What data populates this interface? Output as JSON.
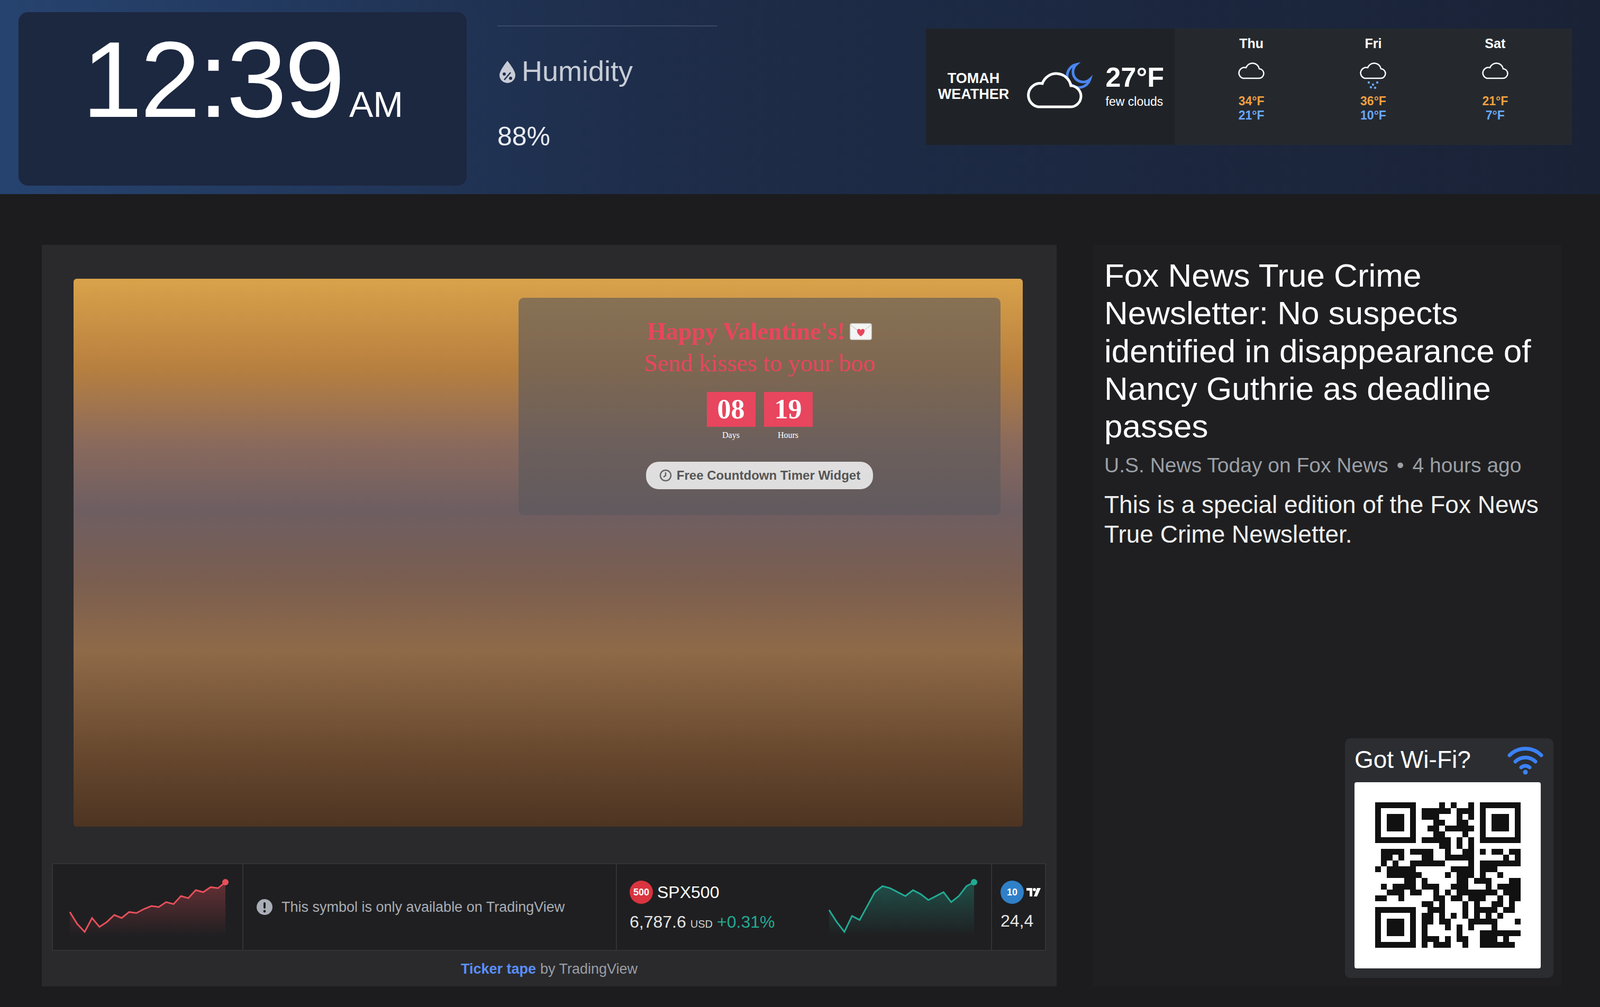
{
  "clock": {
    "time": "12:39",
    "meridiem": "AM"
  },
  "humidity": {
    "label": "Humidity",
    "value": "88%"
  },
  "weather": {
    "title": "TOMAH WEATHER",
    "temp": "27°F",
    "condition": "few clouds",
    "forecast": [
      {
        "day": "Thu",
        "kind": "cloud",
        "high": "34°F",
        "low": "21°F"
      },
      {
        "day": "Fri",
        "kind": "snow",
        "high": "36°F",
        "low": "10°F"
      },
      {
        "day": "Sat",
        "kind": "cloud",
        "high": "21°F",
        "low": "7°F"
      }
    ]
  },
  "countdown": {
    "title": "Happy Valentine's!",
    "subtitle": "Send kisses to your boo",
    "units": [
      {
        "value": "08",
        "label": "Days"
      },
      {
        "value": "19",
        "label": "Hours"
      }
    ],
    "button": "Free Countdown Timer Widget"
  },
  "ticker": {
    "items": [
      {
        "kind": "unavailable",
        "message": "This symbol is only available on TradingView",
        "color": "#e8505b",
        "sparkline": [
          50,
          38,
          30,
          44,
          35,
          40,
          47,
          44,
          50,
          49,
          53,
          56,
          55,
          60,
          58,
          66,
          64,
          72,
          70,
          75,
          74,
          80
        ]
      },
      {
        "kind": "quote",
        "badge": "500",
        "symbol": "SPX500",
        "price": "6,787.6",
        "currency": "USD",
        "change": "+0.31%",
        "color": "#22ab94",
        "sparkline": [
          52,
          40,
          30,
          46,
          42,
          56,
          70,
          76,
          74,
          70,
          66,
          72,
          68,
          62,
          66,
          70,
          60,
          66,
          76,
          80
        ]
      },
      {
        "kind": "partial",
        "badge": "10",
        "price": "24,4",
        "color": "#2f80c8"
      }
    ],
    "credit_link": "Ticker tape",
    "credit_text": "by TradingView"
  },
  "news": {
    "headline": "Fox News True Crime Newsletter: No suspects identified in disappearance of Nancy Guthrie as deadline passes",
    "source": "U.S. News Today on Fox News",
    "separator": "•",
    "age": "4 hours ago",
    "summary": "This is a special edition of the Fox News True Crime Newsletter."
  },
  "wifi": {
    "title": "Got Wi-Fi?"
  }
}
